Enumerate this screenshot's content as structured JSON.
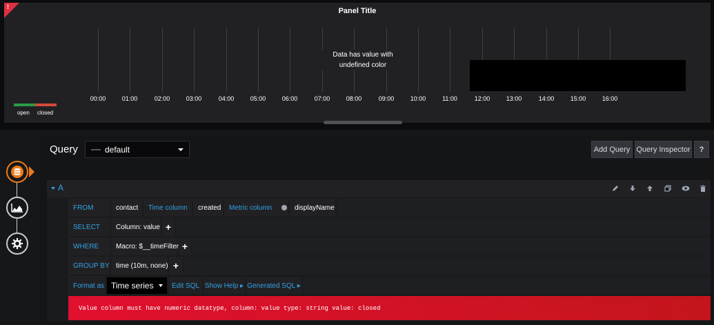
{
  "panel": {
    "title": "Panel Title",
    "corner_mark": "!",
    "undefined_color_msg": "Data has value with undefined color",
    "time_ticks": [
      "00:00",
      "01:00",
      "02:00",
      "03:00",
      "04:00",
      "05:00",
      "06:00",
      "07:00",
      "08:00",
      "09:00",
      "10:00",
      "11:00",
      "12:00",
      "13:00",
      "14:00",
      "15:00",
      "16:00"
    ],
    "legend": [
      {
        "label": "open",
        "color": "#299c46"
      },
      {
        "label": "closed",
        "color": "#d44a3a"
      }
    ]
  },
  "editor": {
    "query_label": "Query",
    "datasource": "default",
    "add_query_label": "Add Query",
    "query_inspector_label": "Query Inspector",
    "help_label": "?",
    "sidebar": [
      {
        "name": "queries",
        "icon": "database-icon",
        "active": true
      },
      {
        "name": "visualization",
        "icon": "chart-icon",
        "active": false
      },
      {
        "name": "general",
        "icon": "gear-icon",
        "active": false
      }
    ]
  },
  "query_row": {
    "ref_id": "A",
    "actions": [
      "edit-icon",
      "move-down-icon",
      "move-up-icon",
      "duplicate-icon",
      "toggle-visibility-icon",
      "delete-icon"
    ],
    "from": {
      "keyword": "FROM",
      "table": "contact",
      "time_column_label": "Time column",
      "time_column": "created",
      "metric_column_label": "Metric column",
      "metric_column": "displayName"
    },
    "select": {
      "keyword": "SELECT",
      "column": "Column: value"
    },
    "where": {
      "keyword": "WHERE",
      "macro": "Macro: $__timeFilter"
    },
    "group_by": {
      "keyword": "GROUP BY",
      "value": "time (10m, none)"
    },
    "format": {
      "label": "Format as",
      "selected": "Time series",
      "edit_sql": "Edit SQL",
      "show_help": "Show Help ▸",
      "generated_sql": "Generated SQL ▸"
    },
    "error": "Value column must have numeric datatype, column: value type: string value: closed"
  },
  "colors": {
    "accent_blue": "#33a2e5",
    "active_orange": "#eb7b18",
    "error_red": "#e0102f",
    "panel_bg": "#212124"
  }
}
